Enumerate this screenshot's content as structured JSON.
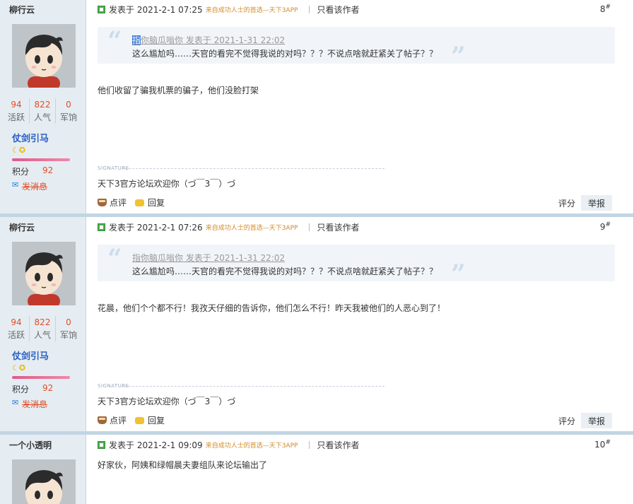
{
  "posts": [
    {
      "author": "柳行云",
      "stats": [
        {
          "value": "94",
          "label": "活跃"
        },
        {
          "value": "822",
          "label": "人气"
        },
        {
          "value": "0",
          "label": "军饷"
        }
      ],
      "rank": "仗剑引马",
      "rank_icons": "☾✪",
      "score_label": "积分",
      "score_value": "92",
      "mail_label": "发消息",
      "posted": "发表于 2021-2-1 07:25",
      "source": "来自成功人士的首选—天下3APP",
      "only_author": "只看该作者",
      "floor_num": "8",
      "floor_sym": "#",
      "quote_selected": "指",
      "quote_head": "你脑瓜嗡你 发表于 2021-1-31 22:02",
      "quote_body": "这么尴尬吗……天官的看完不觉得我说的对吗？？？不说点啥就赶紧关了帖子？？",
      "content": "他们收留了骗我机票的骗子，他们没脸打架",
      "signature_label": "SIGNATURE",
      "signature": "天下3官方论坛欢迎你（づ￣3￣）づ",
      "comment_label": "点评",
      "reply_label": "回复",
      "rate_label": "评分",
      "report_label": "举报"
    },
    {
      "author": "柳行云",
      "stats": [
        {
          "value": "94",
          "label": "活跃"
        },
        {
          "value": "822",
          "label": "人气"
        },
        {
          "value": "0",
          "label": "军饷"
        }
      ],
      "rank": "仗剑引马",
      "rank_icons": "☾✪",
      "score_label": "积分",
      "score_value": "92",
      "mail_label": "发消息",
      "posted": "发表于 2021-2-1 07:26",
      "source": "来自成功人士的首选—天下3APP",
      "only_author": "只看该作者",
      "floor_num": "9",
      "floor_sym": "#",
      "quote_head": "指你脑瓜嗡你 发表于 2021-1-31 22:02",
      "quote_body": "这么尴尬吗……天官的看完不觉得我说的对吗？？？不说点啥就赶紧关了帖子？？",
      "content": "花晨，他们个个都不行！我孜天仔细的告诉你，他们怎么不行！昨天我被他们的人恶心到了！",
      "signature_label": "SIGNATURE",
      "signature": "天下3官方论坛欢迎你（づ￣3￣）づ",
      "comment_label": "点评",
      "reply_label": "回复",
      "rate_label": "评分",
      "report_label": "举报"
    },
    {
      "author": "一个小透明",
      "posted": "发表于 2021-2-1 09:09",
      "source": "来自成功人士的首选—天下3APP",
      "only_author": "只看该作者",
      "floor_num": "10",
      "floor_sym": "#",
      "content": "好家伙，阿姨和绿帽晨夫妻组队来论坛输出了"
    }
  ]
}
